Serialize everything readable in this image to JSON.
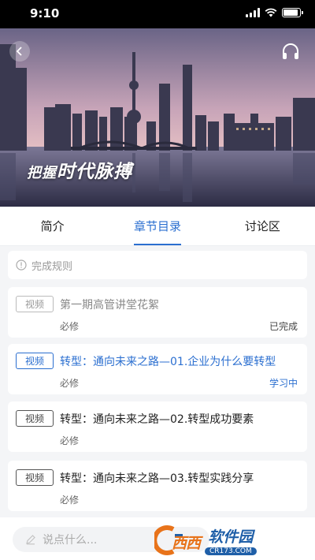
{
  "status_bar": {
    "time": "9:10"
  },
  "banner": {
    "slogan_part1": "把握",
    "slogan_part2": "时代脉搏"
  },
  "tabs": [
    {
      "label": "简介",
      "active": false
    },
    {
      "label": "章节目录",
      "active": true
    },
    {
      "label": "讨论区",
      "active": false
    }
  ],
  "rules": {
    "label": "完成规则"
  },
  "lessons": [
    {
      "tag": "视频",
      "title": "第一期高管讲堂花絮",
      "requirement": "必修",
      "status": "已完成",
      "state": "done"
    },
    {
      "tag": "视频",
      "title": "转型：通向未来之路—01.企业为什么要转型",
      "requirement": "必修",
      "status": "学习中",
      "state": "current"
    },
    {
      "tag": "视频",
      "title": "转型：通向未来之路—02.转型成功要素",
      "requirement": "必修",
      "status": "",
      "state": "todo"
    },
    {
      "tag": "视频",
      "title": "转型：通向未来之路—03.转型实践分享",
      "requirement": "必修",
      "status": "",
      "state": "todo"
    }
  ],
  "comment": {
    "placeholder": "说点什么..."
  },
  "watermark": {
    "name": "西西",
    "site": "软件园",
    "url": "CR173.COM"
  },
  "colors": {
    "accent": "#2b6fd0",
    "background": "#f4f5f7"
  }
}
